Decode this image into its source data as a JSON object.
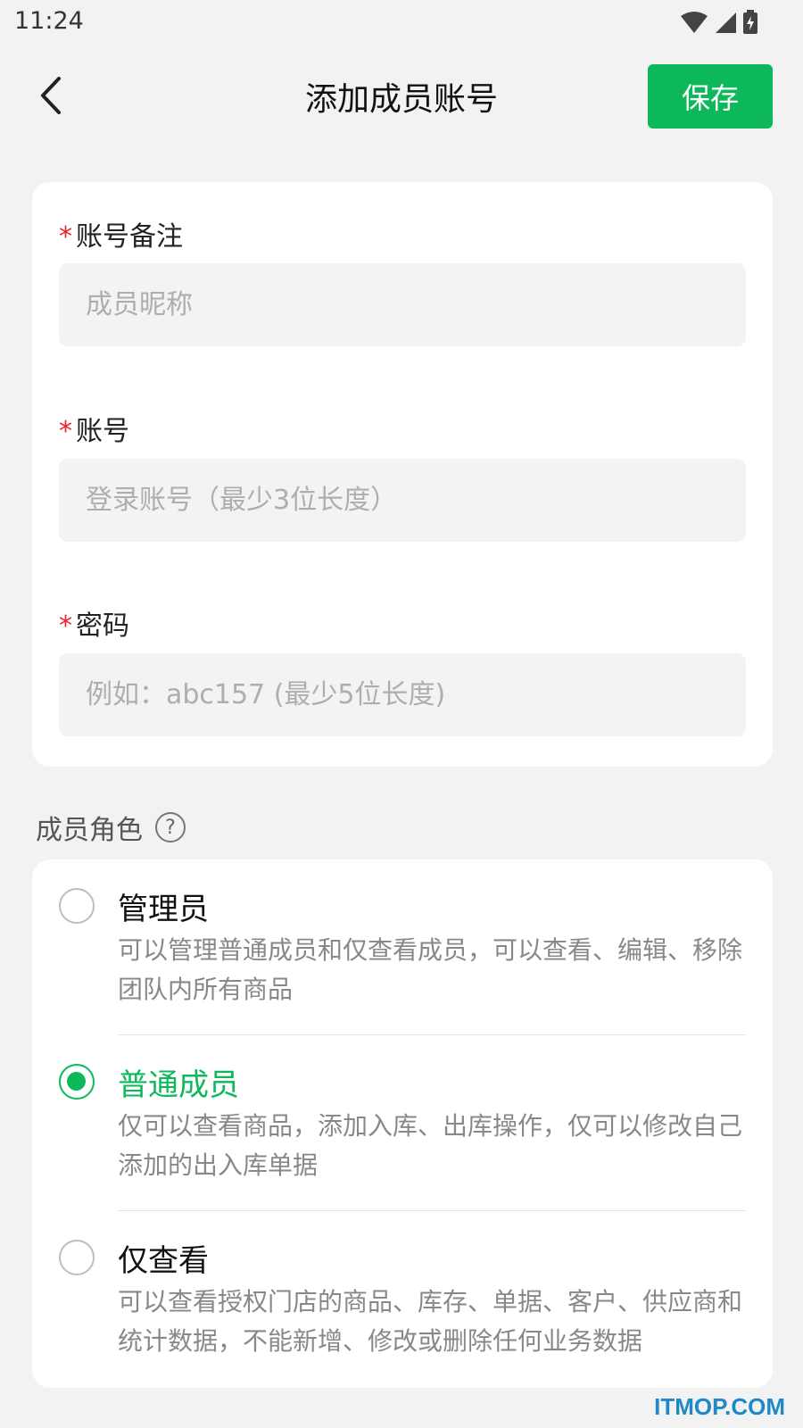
{
  "status_bar": {
    "time": "11:24"
  },
  "header": {
    "title": "添加成员账号",
    "save_label": "保存"
  },
  "form": {
    "fields": [
      {
        "required_mark": "*",
        "label": "账号备注",
        "placeholder": "成员昵称",
        "value": ""
      },
      {
        "required_mark": "*",
        "label": "账号",
        "placeholder": "登录账号（最少3位长度）",
        "value": ""
      },
      {
        "required_mark": "*",
        "label": "密码",
        "placeholder": "例如：abc157 (最少5位长度)",
        "value": ""
      }
    ]
  },
  "roles": {
    "title": "成员角色",
    "help_symbol": "?",
    "selected": "普通成员",
    "options": [
      {
        "name": "管理员",
        "description": "可以管理普通成员和仅查看成员，可以查看、编辑、移除团队内所有商品"
      },
      {
        "name": "普通成员",
        "description": "仅可以查看商品，添加入库、出库操作，仅可以修改自己添加的出入库单据"
      },
      {
        "name": "仅查看",
        "description": "可以查看授权门店的商品、库存、单据、客户、供应商和统计数据，不能新增、修改或删除任何业务数据"
      }
    ]
  },
  "colors": {
    "accent": "#0cb85a",
    "required": "#e8232a",
    "background": "#f2f2f2"
  },
  "watermark": "ITMOP.COM"
}
